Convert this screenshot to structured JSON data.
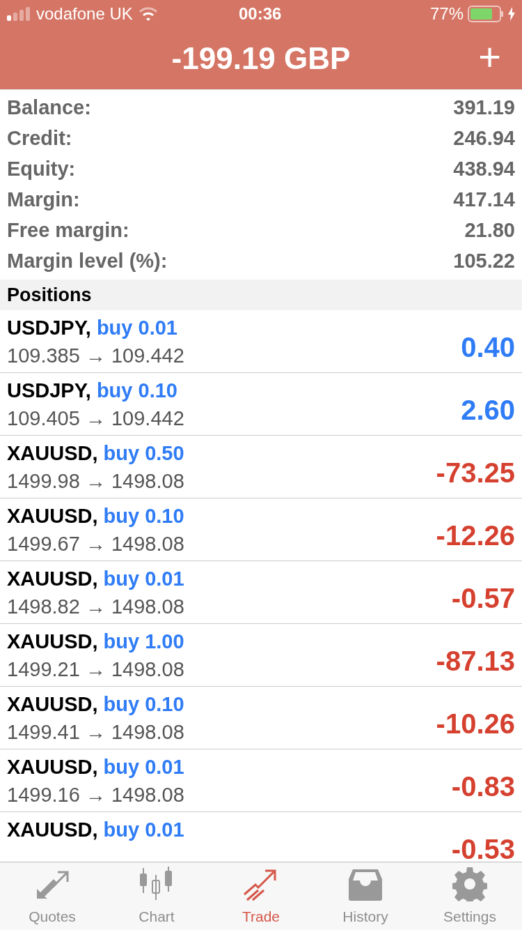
{
  "status_bar": {
    "carrier": "vodafone UK",
    "time": "00:36",
    "battery": "77%"
  },
  "header": {
    "title": "-199.19 GBP",
    "add_button": "+"
  },
  "summary": [
    {
      "label": "Balance:",
      "value": "391.19"
    },
    {
      "label": "Credit:",
      "value": "246.94"
    },
    {
      "label": "Equity:",
      "value": "438.94"
    },
    {
      "label": "Margin:",
      "value": "417.14"
    },
    {
      "label": "Free margin:",
      "value": "21.80"
    },
    {
      "label": "Margin level (%):",
      "value": "105.22"
    }
  ],
  "positions": {
    "title": "Positions",
    "rows": [
      {
        "symbol": "USDJPY,",
        "order": "buy 0.01",
        "prices": "109.385 → 109.442",
        "profit": "0.40",
        "kind": "gain"
      },
      {
        "symbol": "USDJPY,",
        "order": "buy 0.10",
        "prices": "109.405 → 109.442",
        "profit": "2.60",
        "kind": "gain"
      },
      {
        "symbol": "XAUUSD,",
        "order": "buy 0.50",
        "prices": "1499.98 → 1498.08",
        "profit": "-73.25",
        "kind": "loss"
      },
      {
        "symbol": "XAUUSD,",
        "order": "buy 0.10",
        "prices": "1499.67 → 1498.08",
        "profit": "-12.26",
        "kind": "loss"
      },
      {
        "symbol": "XAUUSD,",
        "order": "buy 0.01",
        "prices": "1498.82 → 1498.08",
        "profit": "-0.57",
        "kind": "loss"
      },
      {
        "symbol": "XAUUSD,",
        "order": "buy 1.00",
        "prices": "1499.21 → 1498.08",
        "profit": "-87.13",
        "kind": "loss"
      },
      {
        "symbol": "XAUUSD,",
        "order": "buy 0.10",
        "prices": "1499.41 → 1498.08",
        "profit": "-10.26",
        "kind": "loss"
      },
      {
        "symbol": "XAUUSD,",
        "order": "buy 0.01",
        "prices": "1499.16 → 1498.08",
        "profit": "-0.83",
        "kind": "loss"
      },
      {
        "symbol": "XAUUSD,",
        "order": "buy 0.01",
        "profit": "-0.53",
        "kind": "loss"
      }
    ]
  },
  "tab_bar": [
    {
      "label": "Quotes",
      "kind": "quotes",
      "selected": false
    },
    {
      "label": "Chart",
      "kind": "chart",
      "selected": false
    },
    {
      "label": "Trade",
      "kind": "trade",
      "selected": true
    },
    {
      "label": "History",
      "kind": "history",
      "selected": false
    },
    {
      "label": "Settings",
      "kind": "settings",
      "selected": false
    }
  ]
}
